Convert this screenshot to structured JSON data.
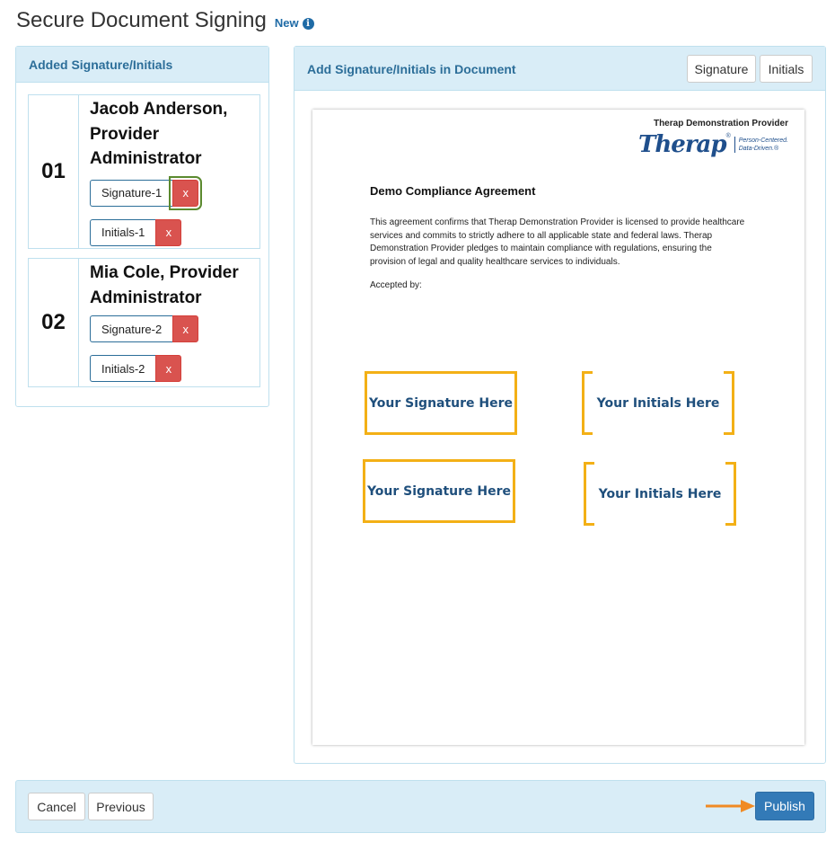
{
  "header": {
    "title": "Secure Document Signing",
    "badge": "New",
    "info_icon": "i"
  },
  "left_panel": {
    "title": "Added Signature/Initials",
    "users": [
      {
        "number": "01",
        "name": "Jacob Anderson, Provider Administrator",
        "signature_tag": "Signature-1",
        "initials_tag": "Initials-1",
        "remove_label": "x"
      },
      {
        "number": "02",
        "name": "Mia Cole, Provider Administrator",
        "signature_tag": "Signature-2",
        "initials_tag": "Initials-2",
        "remove_label": "x"
      }
    ]
  },
  "right_panel": {
    "title": "Add Signature/Initials in Document",
    "signature_button": "Signature",
    "initials_button": "Initials"
  },
  "document": {
    "provider": "Therap Demonstration Provider",
    "logo_text": "Therap",
    "logo_registered": "®",
    "logo_tagline_1": "Person-Centered.",
    "logo_tagline_2": "Data-Driven.",
    "logo_tagline_mark": "®",
    "title": "Demo Compliance Agreement",
    "body": "This agreement confirms that Therap Demonstration Provider is licensed to provide healthcare services and commits to strictly adhere to all applicable state and federal laws. Therap Demonstration Provider pledges to maintain compliance with regulations, ensuring the provision of legal and quality healthcare services to individuals.",
    "accepted_by": "Accepted by:",
    "signature_placeholder": "Your Signature Here",
    "initials_placeholder": "Your Initials Here"
  },
  "footer": {
    "cancel": "Cancel",
    "previous": "Previous",
    "publish": "Publish"
  },
  "colors": {
    "panel_header_bg": "#d9edf7",
    "panel_title": "#2c6e99",
    "remove_red": "#d9534f",
    "publish_blue": "#337ab7",
    "placeholder_border": "#f3b016",
    "arrow": "#f08a24",
    "focus_outline": "#5b8a2f"
  },
  "icons": {
    "info": "info-circle-icon",
    "remove": "close-icon",
    "arrow": "arrow-right-icon"
  }
}
